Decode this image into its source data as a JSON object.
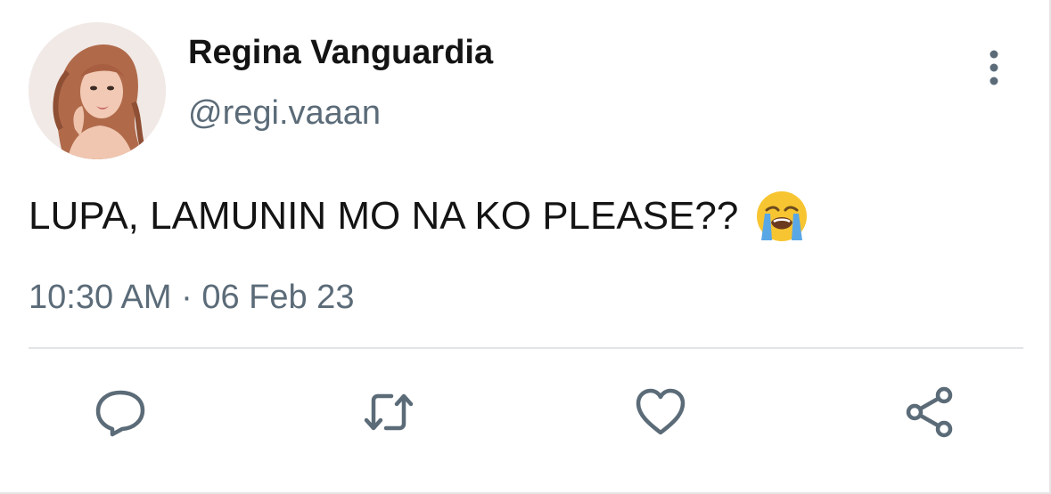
{
  "author": {
    "display_name": "Regina Vanguardia",
    "handle": "@regi.vaaan"
  },
  "tweet": {
    "text": "LUPA, LAMUNIN MO NA KO PLEASE??",
    "emoji": "loudly-crying-face",
    "timestamp": "10:30 AM · 06 Feb 23"
  },
  "actions": {
    "reply": "reply-icon",
    "retweet": "retweet-icon",
    "like": "heart-icon",
    "share": "share-icon"
  },
  "colors": {
    "text_primary": "#141414",
    "text_secondary": "#5b6b78",
    "icon": "#5b6b78",
    "divider": "#e3e5e8"
  }
}
